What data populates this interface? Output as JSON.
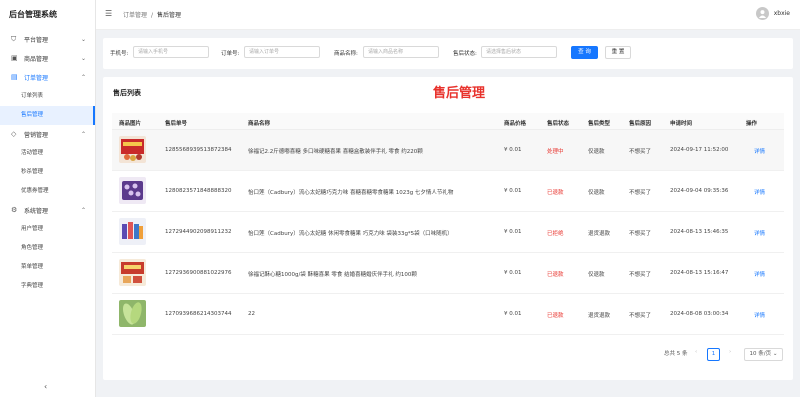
{
  "app": {
    "title": "后台管理系统"
  },
  "sidebar": {
    "groups": [
      {
        "label": "平台管理",
        "icon": "shield-icon",
        "open": false,
        "items": []
      },
      {
        "label": "商品管理",
        "icon": "box-icon",
        "open": false,
        "items": []
      },
      {
        "label": "订单管理",
        "icon": "order-icon",
        "open": true,
        "items": [
          "订单列表",
          "售后管理"
        ]
      },
      {
        "label": "营销管理",
        "icon": "tag-icon",
        "open": false,
        "items": [
          "活动管理",
          "秒杀管理",
          "优惠券管理"
        ]
      },
      {
        "label": "系统管理",
        "icon": "gear-icon",
        "open": false,
        "items": [
          "用户管理",
          "角色管理",
          "菜单管理",
          "字典管理"
        ]
      }
    ],
    "active_item": "售后管理",
    "collapse_icon": "chevron-left-icon"
  },
  "header": {
    "breadcrumb": [
      "订单管理",
      "售后管理"
    ],
    "username": "xbxie"
  },
  "filters": {
    "phone_label": "手机号:",
    "phone_placeholder": "请输入手机号",
    "order_label": "订单号:",
    "order_placeholder": "请输入订单号",
    "product_label": "商品名称:",
    "product_placeholder": "请输入商品名称",
    "status_label": "售后状态:",
    "status_placeholder": "请选择售后状态",
    "search_label": "查 询",
    "reset_label": "重 置"
  },
  "list": {
    "title": "售后列表",
    "heading": "售后管理",
    "columns": [
      "商品图片",
      "售后单号",
      "商品名称",
      "商品价格",
      "售后状态",
      "售后类型",
      "售后原因",
      "申请时间",
      "操作"
    ],
    "rows": [
      {
        "image": "snack-red-pack",
        "no": "1285568939513872384",
        "name": "徐福记2.2斤德嘟喜糖 多口味硬糖喜果 喜糖盒散装伴手礼 零食 约220颗",
        "price": "¥ 0.01",
        "status": "处理中",
        "type": "仅退款",
        "reason": "不想买了",
        "time": "2024-09-17 11:52:00",
        "action": "详情"
      },
      {
        "image": "candy-purple-bag",
        "no": "1280823571848888320",
        "name": "怡口莲（Cadbury）流心太妃糖巧克力味 喜糖喜糖零食糖果 1023g 七夕情人节礼物",
        "price": "¥ 0.01",
        "status": "已退款",
        "type": "仅退款",
        "reason": "不想买了",
        "time": "2024-09-04 09:35:36",
        "action": "详情"
      },
      {
        "image": "candy-box-multi",
        "no": "1272944902098911232",
        "name": "怡口莲（Cadbury）流心太妃糖 休闲零食糖果 巧克力味 袋装33g*5袋（口味随机）",
        "price": "¥ 0.01",
        "status": "已拒绝",
        "type": "退货退款",
        "reason": "不想买了",
        "time": "2024-08-13 15:46:35",
        "action": "详情"
      },
      {
        "image": "snack-red-pack",
        "no": "1272936900881022976",
        "name": "徐福记酥心糖1000g/袋 酥糖喜果 零食 结婚喜糖婚庆伴手礼 约100颗",
        "price": "¥ 0.01",
        "status": "已退款",
        "type": "仅退款",
        "reason": "不想买了",
        "time": "2024-08-13 15:16:47",
        "action": "详情"
      },
      {
        "image": "green-veg",
        "no": "1270939686214303744",
        "name": "22",
        "price": "¥ 0.01",
        "status": "已退款",
        "type": "退货退款",
        "reason": "不想买了",
        "time": "2024-08-08 03:00:34",
        "action": "详情"
      }
    ]
  },
  "pagination": {
    "total_text": "总共 5 条",
    "current_page": "1",
    "prev_icon": "chevron-left-icon",
    "next_icon": "chevron-right-icon",
    "page_size": "10 条/页"
  },
  "colors": {
    "primary": "#1677ff",
    "danger": "#e8322c"
  }
}
